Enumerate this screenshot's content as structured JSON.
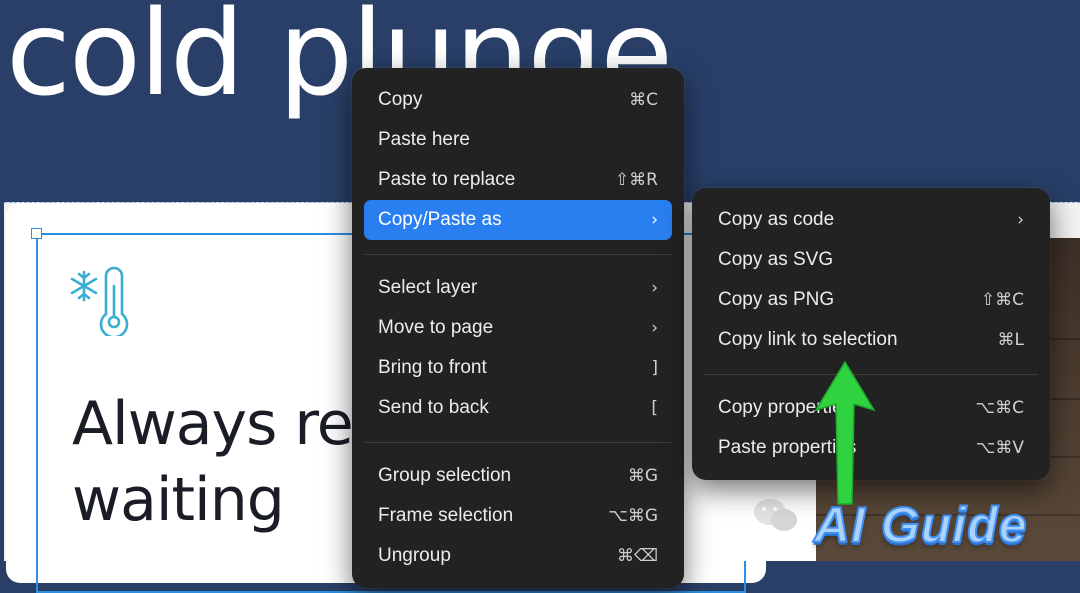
{
  "hero": {
    "title": "cold plunge"
  },
  "card": {
    "heading": "Always re\nwaiting"
  },
  "context_menu": {
    "items": [
      {
        "label": "Copy",
        "shortcut": "⌘C"
      },
      {
        "label": "Paste here",
        "shortcut": ""
      },
      {
        "label": "Paste to replace",
        "shortcut": "⇧⌘R"
      },
      {
        "label": "Copy/Paste as",
        "shortcut": "›",
        "active": true
      },
      {
        "label": "Select layer",
        "shortcut": "›"
      },
      {
        "label": "Move to page",
        "shortcut": "›"
      },
      {
        "label": "Bring to front",
        "shortcut": "]"
      },
      {
        "label": "Send to back",
        "shortcut": "["
      },
      {
        "label": "Group selection",
        "shortcut": "⌘G"
      },
      {
        "label": "Frame selection",
        "shortcut": "⌥⌘G"
      },
      {
        "label": "Ungroup",
        "shortcut": "⌘⌫"
      }
    ]
  },
  "submenu": {
    "items": [
      {
        "label": "Copy as code",
        "shortcut": "›"
      },
      {
        "label": "Copy as SVG",
        "shortcut": ""
      },
      {
        "label": "Copy as PNG",
        "shortcut": "⇧⌘C"
      },
      {
        "label": "Copy link to selection",
        "shortcut": "⌘L"
      },
      {
        "label": "Copy properties",
        "shortcut": "⌥⌘C"
      },
      {
        "label": "Paste properties",
        "shortcut": "⌥⌘V"
      }
    ]
  },
  "watermark": {
    "text": "AI Guide"
  },
  "colors": {
    "hero_background": "#293f68",
    "menu_background": "#222222",
    "menu_highlight": "#2a7ff0",
    "selection_outline": "#2d8fe0",
    "icon_teal": "#3aaed0",
    "arrow_green": "#2fd23f"
  },
  "icons": [
    "snowflake-thermometer-icon",
    "chevron-right-icon",
    "wechat-icon",
    "green-up-arrow-annotation"
  ]
}
